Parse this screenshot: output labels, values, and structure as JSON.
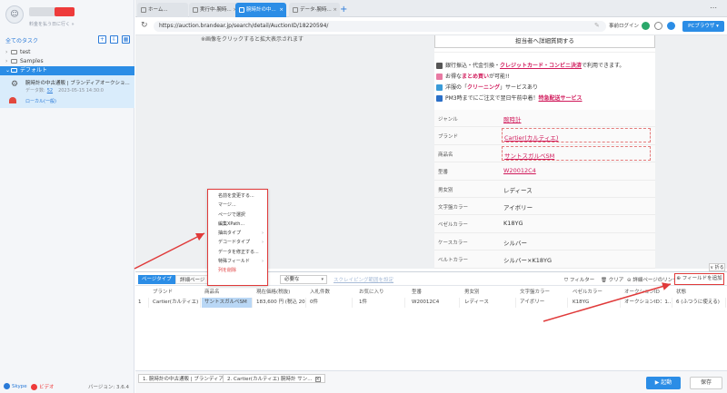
{
  "sidebar": {
    "user_link": "料金を払う日に行く »",
    "all_tasks": "全てのタスク",
    "tree": [
      {
        "label": "test"
      },
      {
        "label": "Samples"
      },
      {
        "label": "デフォルト"
      }
    ],
    "task": {
      "title": "腕時計の中古通販 | ブランディアオークショ...",
      "meta_label": "データ数:",
      "meta_count": "52",
      "meta_date": "2023-05-15 14:30:0",
      "crawl": "ローカル(一般)"
    },
    "footer": {
      "skype": "Skype",
      "video": "ビデオ",
      "version": "バージョン: 3.6.4"
    }
  },
  "browser": {
    "tabs": [
      {
        "label": "ホーム..."
      },
      {
        "label": "実行中-腕時..."
      },
      {
        "label": "腕時計の中..."
      },
      {
        "label": "データ-腕時..."
      }
    ],
    "url": "https://auction.brandear.jp/search/detail/AuctionID/18220594/",
    "login": "事前ログイン",
    "pc_browser": "PCブラウザ",
    "page": {
      "cutoff_text": "※画像をクリックすると拡大表示されます",
      "inquire": "担当者へ詳細質問する",
      "promo": [
        {
          "pre": "銀行振込・代金引換・",
          "em": "クレジットカード・コンビニ決済",
          "post": "で利用できます。"
        },
        {
          "pre": "お得な",
          "em": "まとめ買い",
          "post": "が可能!!"
        },
        {
          "pre": "洋服の「",
          "em": "クリーニング",
          "post": "」サービスあり"
        },
        {
          "pre": "PM3時までにご注文で翌日午前中着！",
          "em": "特急配送サービス",
          "post": ""
        }
      ],
      "spec": [
        {
          "k": "ジャンル",
          "v": "腕時計"
        },
        {
          "k": "ブランド",
          "v": "Cartier(カルティエ)"
        },
        {
          "k": "商品名",
          "v": "サントスガルベSM"
        },
        {
          "k": "型番",
          "v": "W20012C4"
        },
        {
          "k": "男女別",
          "v": "レディース"
        },
        {
          "k": "文字盤カラー",
          "v": "アイボリー"
        },
        {
          "k": "ベゼルカラー",
          "v": "K18YG"
        },
        {
          "k": "ケースカラー",
          "v": "シルバー"
        },
        {
          "k": "ベルトカラー",
          "v": "シルバー×K18YG"
        }
      ]
    }
  },
  "context_menu": {
    "items": [
      {
        "label": "名前を変更する..."
      },
      {
        "label": "マージ..."
      },
      {
        "label": "ページで選択"
      },
      {
        "label": "編集XPath..."
      },
      {
        "label": "抽出タイプ"
      },
      {
        "label": "デコードタイプ"
      },
      {
        "label": "データを修正する..."
      },
      {
        "label": "特殊フィールド"
      },
      {
        "label": "列を削除"
      }
    ]
  },
  "data_panel": {
    "collapse": "∨ 折る",
    "preview_btn": "ページタイプ",
    "detail_btn": "詳細ページ",
    "select_value": "必要な",
    "link": "スクレイピング範囲を設定",
    "filter": "フィルター",
    "clear": "クリア",
    "detail_link": "詳細ページのリンク",
    "add_field": "フィールドを追加",
    "headers": [
      "ブランド",
      "商品名",
      "現在価格(税抜)",
      "入札件数",
      "お気に入り",
      "型番",
      "男女別",
      "文字盤カラー",
      "ベゼルカラー",
      "オークションID",
      "状態"
    ],
    "row": [
      "1",
      "Cartier(カルティエ)",
      "サントスガルベSM",
      "183,600 円 (税込 20...",
      "0件",
      "1件",
      "W20012C4",
      "レディース",
      "アイボリー",
      "K18YG",
      "オークションID：1...",
      "6 (ふつうに使える)"
    ]
  },
  "bottom": {
    "tabs": [
      {
        "label": "1. 腕時計の中古通販 | ブランディア..."
      },
      {
        "label": "2. Cartier(カルティエ) 腕時計 サン..."
      }
    ],
    "start": "▶ 起動",
    "save": "保存"
  },
  "colors": {
    "accent": "#2b8de6",
    "link": "#d0195a",
    "annotation": "#e03a3a"
  }
}
